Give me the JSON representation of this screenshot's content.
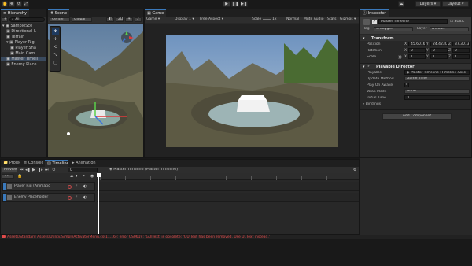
{
  "toolbar": {
    "play_icon": "play-icon",
    "pause_icon": "pause-icon",
    "step_icon": "step-icon",
    "layers_label": "Layers",
    "layout_label": "Layout"
  },
  "hierarchy": {
    "tab_label": "Hierarchy",
    "add_label": "+",
    "search_placeholder": "All",
    "items": [
      {
        "label": "SampleSce",
        "indent": 0
      },
      {
        "label": "Directional L",
        "indent": 1
      },
      {
        "label": "Terrain",
        "indent": 1
      },
      {
        "label": "Player Rig",
        "indent": 1
      },
      {
        "label": "Player Sha",
        "indent": 2
      },
      {
        "label": "Main Cam",
        "indent": 2
      },
      {
        "label": "Master Timeli",
        "indent": 1
      },
      {
        "label": "Enemy Place",
        "indent": 1
      }
    ]
  },
  "scene": {
    "tab_label": "Scene",
    "pivot_label": "Center",
    "global_label": "Global"
  },
  "game": {
    "tab_label": "Game",
    "game_dropdown": "Game",
    "display_label": "Display 1",
    "aspect_label": "Free Aspect",
    "scale_label": "Scale",
    "scale_value": "1x",
    "play_mode_label": "Normal",
    "mute_label": "Mute Audio",
    "stats_label": "Stats",
    "gizmos_label": "Gizmos"
  },
  "inspector": {
    "tab_label": "Inspector",
    "object_name": "Master Timeline",
    "static_label": "Static",
    "tag_label": "Tag",
    "tag_value": "Untagged",
    "layer_label": "Layer",
    "layer_value": "Default",
    "transform": {
      "title": "Transform",
      "position_label": "Position",
      "position": [
        "45.6016",
        "24.423C",
        "37.3013"
      ],
      "rotation_label": "Rotation",
      "rotation": [
        "0",
        "0",
        "0"
      ],
      "scale_label": "Scale",
      "scale": [
        "1",
        "1",
        "1"
      ]
    },
    "director": {
      "title": "Playable Director",
      "playable_label": "Playable",
      "playable_value": "Master Timeline (Timeline Asse",
      "update_method_label": "Update Method",
      "update_method_value": "Game Time",
      "play_on_awake_label": "Play On Awake",
      "play_on_awake": "✓",
      "wrap_mode_label": "Wrap Mode",
      "wrap_mode_value": "None",
      "initial_time_label": "Initial Time",
      "initial_time_value": "0",
      "bindings_label": "Bindings"
    },
    "add_component_label": "Add Component"
  },
  "bottom": {
    "tabs": [
      "Project",
      "Console",
      "Timeline",
      "Animation"
    ],
    "active_tab": "Timeline",
    "preview_label": "Preview",
    "frame_value": "0",
    "timeline_asset": "Master Timeline (Master Timeline)",
    "ruler_ticks": [
      "0",
      "60",
      "120",
      "180",
      "240",
      "300",
      "360",
      "420",
      "480",
      "540"
    ],
    "tracks": [
      {
        "label": "Player Rig (Animatio"
      },
      {
        "label": "Enemy Placeholder"
      }
    ]
  },
  "console": {
    "error_text": "Assets/Standard Assets/Utility/SimpleActivatorMenu.cs(11,16): error CS0619: 'GUIText' is obsolete: 'GUIText has been removed. Use UI.Text instead.'"
  },
  "colors": {
    "accent": "#3a79bb",
    "error": "#e04a4a",
    "playhead": "#ffffff"
  }
}
